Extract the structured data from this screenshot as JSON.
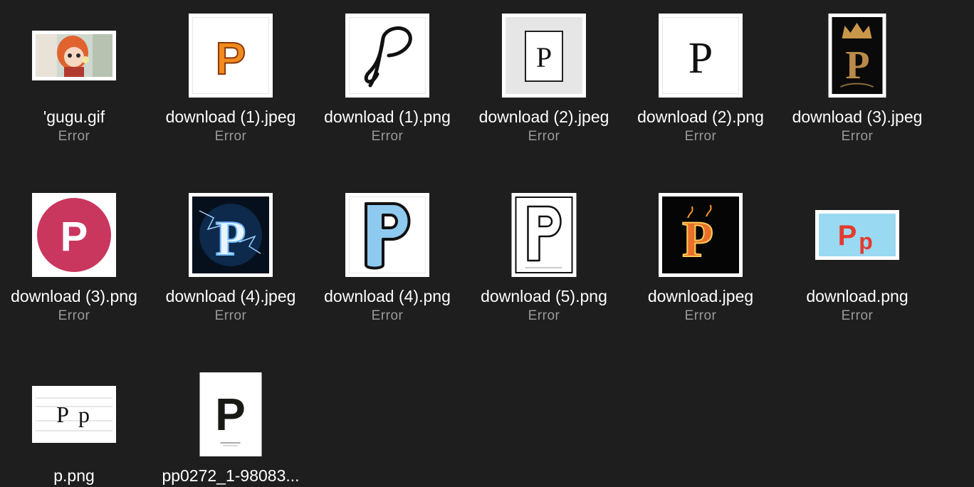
{
  "files": [
    {
      "name": "'gugu.gif",
      "status": "Error",
      "thumb": "anime-character-icon"
    },
    {
      "name": "download (1).jpeg",
      "status": "Error",
      "thumb": "orange-p-icon"
    },
    {
      "name": "download (1).png",
      "status": "Error",
      "thumb": "script-p-icon"
    },
    {
      "name": "download (2).jpeg",
      "status": "Error",
      "thumb": "framed-serif-p-icon"
    },
    {
      "name": "download (2).png",
      "status": "Error",
      "thumb": "serif-p-icon"
    },
    {
      "name": "download (3).jpeg",
      "status": "Error",
      "thumb": "crown-gold-p-icon"
    },
    {
      "name": "download (3).png",
      "status": "Error",
      "thumb": "pink-circle-p-icon"
    },
    {
      "name": "download (4).jpeg",
      "status": "Error",
      "thumb": "lightning-p-icon"
    },
    {
      "name": "download (4).png",
      "status": "Error",
      "thumb": "blue-bubble-p-icon"
    },
    {
      "name": "download (5).png",
      "status": "Error",
      "thumb": "outline-p-icon"
    },
    {
      "name": "download.jpeg",
      "status": "Error",
      "thumb": "fire-p-icon"
    },
    {
      "name": "download.png",
      "status": "Error",
      "thumb": "red-pp-icon"
    },
    {
      "name": "p.png",
      "status": "",
      "thumb": "handwriting-pp-icon"
    },
    {
      "name": "pp0272_1-98083...",
      "status": "",
      "thumb": "poster-p-icon"
    }
  ]
}
